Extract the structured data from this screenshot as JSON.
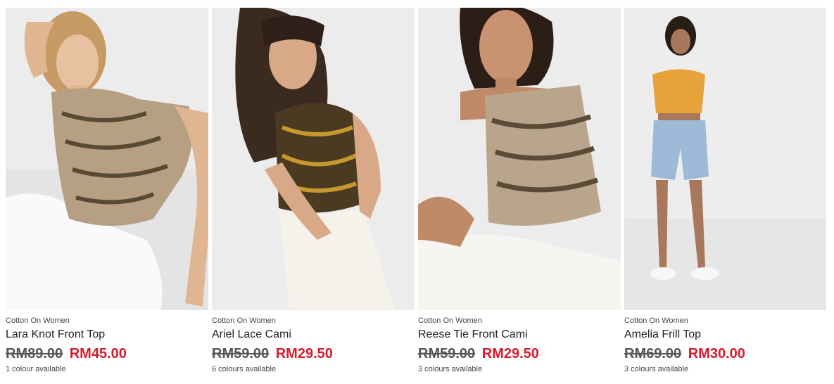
{
  "products": [
    {
      "brand": "Cotton On Women",
      "name": "Lara Knot Front Top",
      "was_price": "RM89.00",
      "now_price": "RM45.00",
      "colours": "1 colour available",
      "top_color": "#b69f83"
    },
    {
      "brand": "Cotton On Women",
      "name": "Ariel Lace Cami",
      "was_price": "RM59.00",
      "now_price": "RM29.50",
      "colours": "6 colours available",
      "top_color": "#4a3a22"
    },
    {
      "brand": "Cotton On Women",
      "name": "Reese Tie Front Cami",
      "was_price": "RM59.00",
      "now_price": "RM29.50",
      "colours": "3 colours available",
      "top_color": "#b9a58c"
    },
    {
      "brand": "Cotton On Women",
      "name": "Amelia Frill Top",
      "was_price": "RM69.00",
      "now_price": "RM30.00",
      "colours": "3 colours available",
      "top_color": "#e8a23a"
    }
  ],
  "colors": {
    "sale_price": "#d81b2b",
    "was_price": "#555555",
    "photo_bg": "#ececec"
  }
}
